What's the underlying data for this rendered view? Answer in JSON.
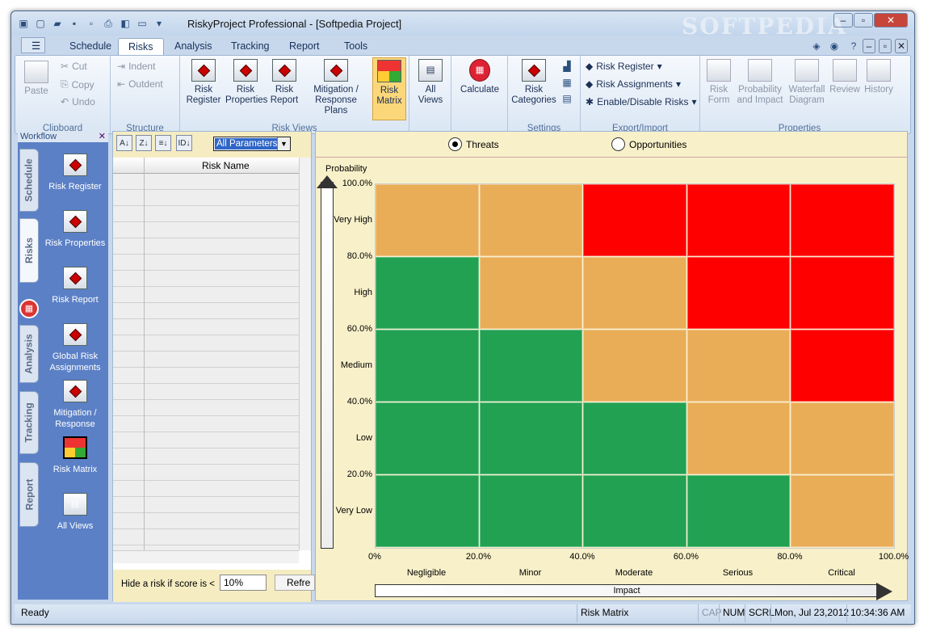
{
  "window": {
    "title": "RiskyProject Professional - [Softpedia Project]",
    "watermark": "SOFTPEDIA"
  },
  "menu_tabs": [
    "Schedule",
    "Risks",
    "Analysis",
    "Tracking",
    "Report",
    "Tools"
  ],
  "ribbon": {
    "clipboard": {
      "label": "Clipboard",
      "paste": "Paste",
      "cut": "Cut",
      "copy": "Copy",
      "undo": "Undo"
    },
    "structure": {
      "label": "Structure",
      "indent": "Indent",
      "outdent": "Outdent"
    },
    "risk_views": {
      "label": "Risk Views",
      "register": "Risk Register",
      "properties": "Risk Properties",
      "report": "Risk Report",
      "mitigation": "Mitigation / Response Plans",
      "matrix": "Risk Matrix"
    },
    "all_views": "All Views",
    "calculate": "Calculate",
    "settings": {
      "label": "Settings",
      "categories": "Risk Categories"
    },
    "export": {
      "label": "Export/Import",
      "register": "Risk Register",
      "assignments": "Risk Assignments",
      "enable": "Enable/Disable Risks"
    },
    "properties": {
      "label": "Properties",
      "form": "Risk Form",
      "prob_impact": "Probability and Impact",
      "waterfall": "Waterfall Diagram",
      "review": "Review",
      "history": "History"
    }
  },
  "workflow": {
    "title": "Workflow",
    "tabs": [
      "Schedule",
      "Risks",
      "Analysis",
      "Tracking",
      "Report"
    ],
    "items": [
      "Risk Register",
      "Risk Properties",
      "Risk Report",
      "Global Risk Assignments",
      "Mitigation / Response",
      "Risk Matrix",
      "All Views"
    ]
  },
  "left_panel": {
    "filter": "All Parameters",
    "column": "Risk Name",
    "hide_label": "Hide a risk if score is <",
    "hide_value": "10%",
    "refresh": "Refre"
  },
  "matrix": {
    "threats": "Threats",
    "opportunities": "Opportunities",
    "ylabel": "Probability",
    "xlabel": "Impact",
    "yticks": [
      "100.0%",
      "80.0%",
      "60.0%",
      "40.0%",
      "20.0%"
    ],
    "ycats": [
      "Very High",
      "High",
      "Medium",
      "Low",
      "Very Low"
    ],
    "xticks": [
      "0%",
      "20.0%",
      "40.0%",
      "60.0%",
      "80.0%",
      "100.0%"
    ],
    "xcats": [
      "Negligible",
      "Minor",
      "Moderate",
      "Serious",
      "Critical"
    ],
    "cells": [
      [
        "amber",
        "amber",
        "red",
        "red",
        "red"
      ],
      [
        "green",
        "amber",
        "amber",
        "red",
        "red"
      ],
      [
        "green",
        "green",
        "amber",
        "amber",
        "red"
      ],
      [
        "green",
        "green",
        "green",
        "amber",
        "amber"
      ],
      [
        "green",
        "green",
        "green",
        "green",
        "amber"
      ]
    ],
    "colors": {
      "red": "#ff0000",
      "amber": "#e9ad57",
      "green": "#22a152"
    }
  },
  "status": {
    "ready": "Ready",
    "view": "Risk Matrix",
    "cap": "CAP",
    "num": "NUM",
    "scrl": "SCRL",
    "date": "Mon, Jul 23,2012",
    "time": "10:34:36 AM"
  }
}
